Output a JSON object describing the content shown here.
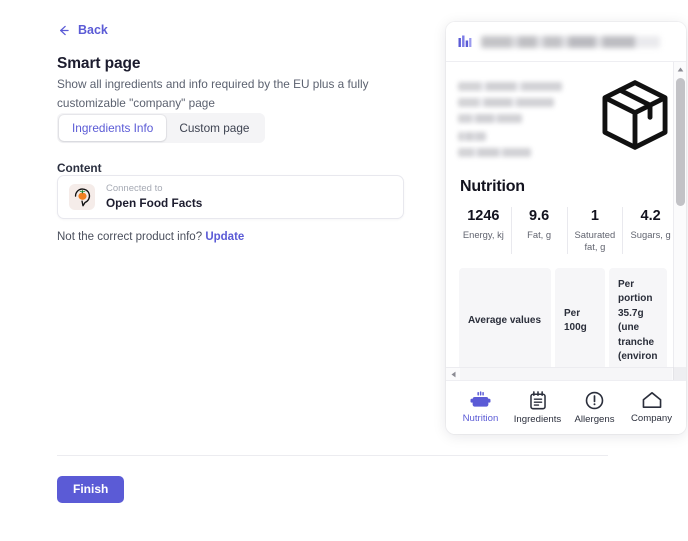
{
  "nav": {
    "back_label": "Back",
    "back_icon": "arrow-left-icon"
  },
  "header": {
    "title": "Smart page",
    "subtitle": "Show all ingredients and info required by the EU plus a fully customizable \"company\" page"
  },
  "tabs": [
    {
      "label": "Ingredients Info",
      "active": true
    },
    {
      "label": "Custom page",
      "active": false
    }
  ],
  "content": {
    "section_label": "Content",
    "connected_to_label": "Connected to",
    "source_name": "Open Food Facts",
    "source_icon": "open-food-facts-logo",
    "prompt_text": "Not the correct product info?",
    "update_link": "Update"
  },
  "footer": {
    "finish_label": "Finish"
  },
  "preview": {
    "header": {
      "logo_icon": "brand-bars-logo",
      "title_redacted": true
    },
    "hero": {
      "product_icon": "package-box-icon",
      "description_redacted": true
    },
    "nutrition": {
      "heading": "Nutrition",
      "facts": [
        {
          "value": "1246",
          "label": "Energy, kj"
        },
        {
          "value": "9.6",
          "label": "Fat, g"
        },
        {
          "value": "1",
          "label": "Saturated fat, g"
        },
        {
          "value": "4.2",
          "label": "Sugars, g"
        }
      ],
      "table_headers": [
        "Average values",
        "Per 100g",
        "Per portion 35.7g (une tranche (environ"
      ]
    },
    "tabs": [
      {
        "label": "Nutrition",
        "icon": "pot-icon",
        "active": true
      },
      {
        "label": "Ingredients",
        "icon": "notepad-icon",
        "active": false
      },
      {
        "label": "Allergens",
        "icon": "exclamation-circle-icon",
        "active": false
      },
      {
        "label": "Company",
        "icon": "home-icon",
        "active": false
      }
    ],
    "scrollbars": {
      "vertical_up": "scroll-up-arrow",
      "vertical_down": "scroll-down-arrow",
      "horizontal_left": "scroll-left-arrow",
      "horizontal_right": "scroll-right-arrow"
    }
  },
  "colors": {
    "accent": "#5b5bd6",
    "text": "#1c1c2e",
    "muted": "#5c6270"
  }
}
